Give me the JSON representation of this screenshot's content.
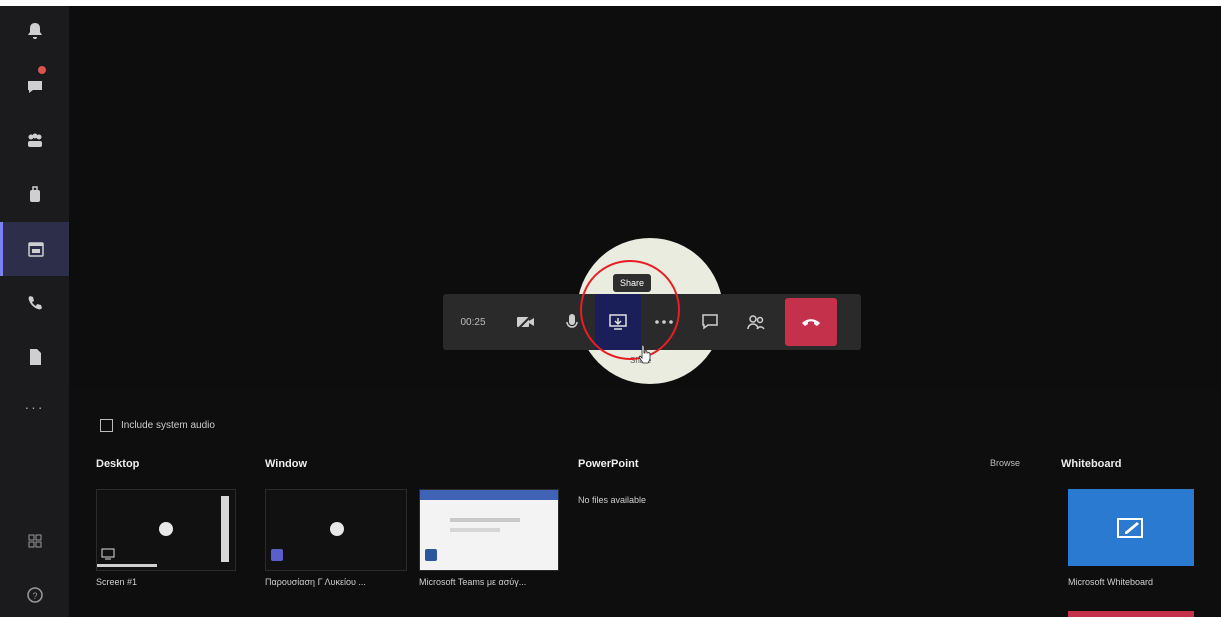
{
  "meeting": {
    "timer": "00:25",
    "share_tooltip": "Share",
    "spotlight_label": "Share"
  },
  "share_tray": {
    "include_audio_label": "Include system audio",
    "desktop": {
      "heading": "Desktop",
      "items": [
        {
          "caption": "Screen #1"
        }
      ]
    },
    "window": {
      "heading": "Window",
      "items": [
        {
          "caption": "Παρουσίαση Γ Λυκείου ..."
        },
        {
          "caption": "Microsoft Teams με ασύγ..."
        }
      ]
    },
    "powerpoint": {
      "heading": "PowerPoint",
      "empty_text": "No files available"
    },
    "browse_label": "Browse",
    "whiteboard": {
      "heading": "Whiteboard",
      "caption": "Microsoft Whiteboard"
    }
  },
  "colors": {
    "leave": "#c4314b",
    "share_active": "#1a1f5a",
    "whiteboard": "#2b7ad1",
    "annotation": "#e81e25",
    "rail_active": "#7b83eb"
  }
}
